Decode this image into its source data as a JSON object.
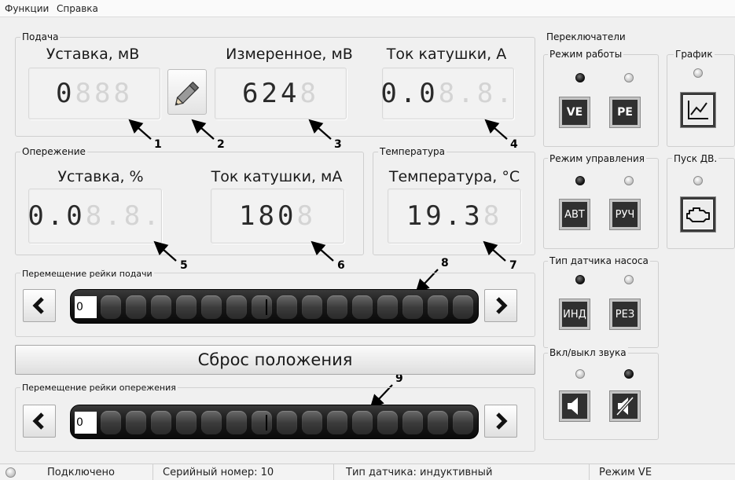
{
  "menu": {
    "functions": "Функции",
    "help": "Справка"
  },
  "supply": {
    "group_title": "Подача",
    "setpoint_label": "Уставка, мВ",
    "setpoint_value": "0",
    "setpoint_ghost": "888",
    "measured_label": "Измеренное, мВ",
    "measured_value": "624",
    "measured_ghost": "8",
    "coil_label": "Ток катушки, А",
    "coil_value": "0.0",
    "coil_ghost": "8.8."
  },
  "advance": {
    "group_title": "Опережение",
    "setpoint_label": "Уставка, %",
    "setpoint_value": "0.0",
    "setpoint_ghost": "8.8.",
    "coil_label": "Ток катушки, мА",
    "coil_value": "180",
    "coil_ghost": "8"
  },
  "temperature": {
    "group_title": "Температура",
    "label": "Температура, °С",
    "value": "19.3",
    "ghost": "8"
  },
  "callouts": [
    "1",
    "2",
    "3",
    "4",
    "5",
    "6",
    "7",
    "8",
    "9"
  ],
  "supply_rail": {
    "title": "Перемещение рейки подачи",
    "value": "0"
  },
  "reset_button": "Сброс положения",
  "advance_rail": {
    "title": "Перемещение рейки опережения",
    "value": "0"
  },
  "switches": {
    "group_title": "Переключатели",
    "mode": {
      "title": "Режим работы",
      "btn_ve": "VE",
      "btn_pe": "PE",
      "active": "VE"
    },
    "graph": {
      "title": "График",
      "icon": "chart-icon"
    },
    "control": {
      "title": "Режим управления",
      "btn_auto": "АВТ",
      "btn_manual": "РУЧ",
      "active": "АВТ"
    },
    "engine": {
      "title": "Пуск ДВ.",
      "icon": "engine-icon"
    },
    "sensor": {
      "title": "Тип датчика насоса",
      "btn_ind": "ИНД",
      "btn_res": "РЕЗ",
      "active": "ИНД"
    },
    "sound": {
      "title": "Вкл/выкл звука",
      "icon_on": "speaker-icon",
      "icon_off": "speaker-mute-icon",
      "active": "off"
    }
  },
  "status": {
    "connection": "Подключено",
    "serial": "Серийный номер: 10",
    "sensor_type": "Тип датчика: индуктивный",
    "mode": "Режим VE"
  },
  "colors": {
    "led_on": "#111111",
    "led_off": "#bdbdbd",
    "switch_button": "#303030"
  }
}
